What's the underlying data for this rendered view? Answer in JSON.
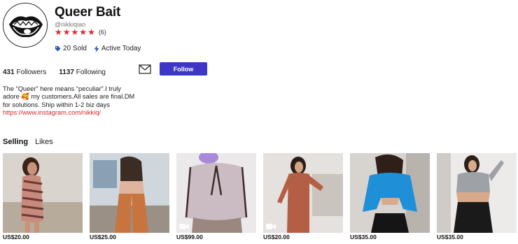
{
  "shop": {
    "title": "Queer Bait",
    "handle": "@nikkiqiao",
    "rating_count": "(6)",
    "sold": "20 Sold",
    "active": "Active Today"
  },
  "stats": {
    "followers_count": "431",
    "followers_label": "Followers",
    "following_count": "1137",
    "following_label": "Following"
  },
  "actions": {
    "follow_label": "Follow"
  },
  "bio": {
    "line1": "The “Queer” here means “peculiar”.I truly adore",
    "line1_emoji": "🥰",
    "line1_tail": " my customers.All sales are final.DM for solutions. Ship within 1-2 biz days",
    "link": "https://www.instagram.com/nikkiq/"
  },
  "tabs": {
    "selling": "Selling",
    "likes": "Likes"
  },
  "colors": {
    "accent": "#3e36c7",
    "star": "#e0272c",
    "link": "#d7262d"
  },
  "products": [
    {
      "price": "US$20.00",
      "outfit": "zebra-print mini dress",
      "video": false
    },
    {
      "price": "US$25.00",
      "outfit": "rust flared pants",
      "video": false
    },
    {
      "price": "US$99.00",
      "outfit": "lavender cropped top",
      "video": true
    },
    {
      "price": "US$20.00",
      "outfit": "rust jumpsuit",
      "video": true
    },
    {
      "price": "US$35.00",
      "outfit": "blue cut-out top",
      "video": false
    },
    {
      "price": "US$35.00",
      "outfit": "grey crop top",
      "video": false
    }
  ]
}
